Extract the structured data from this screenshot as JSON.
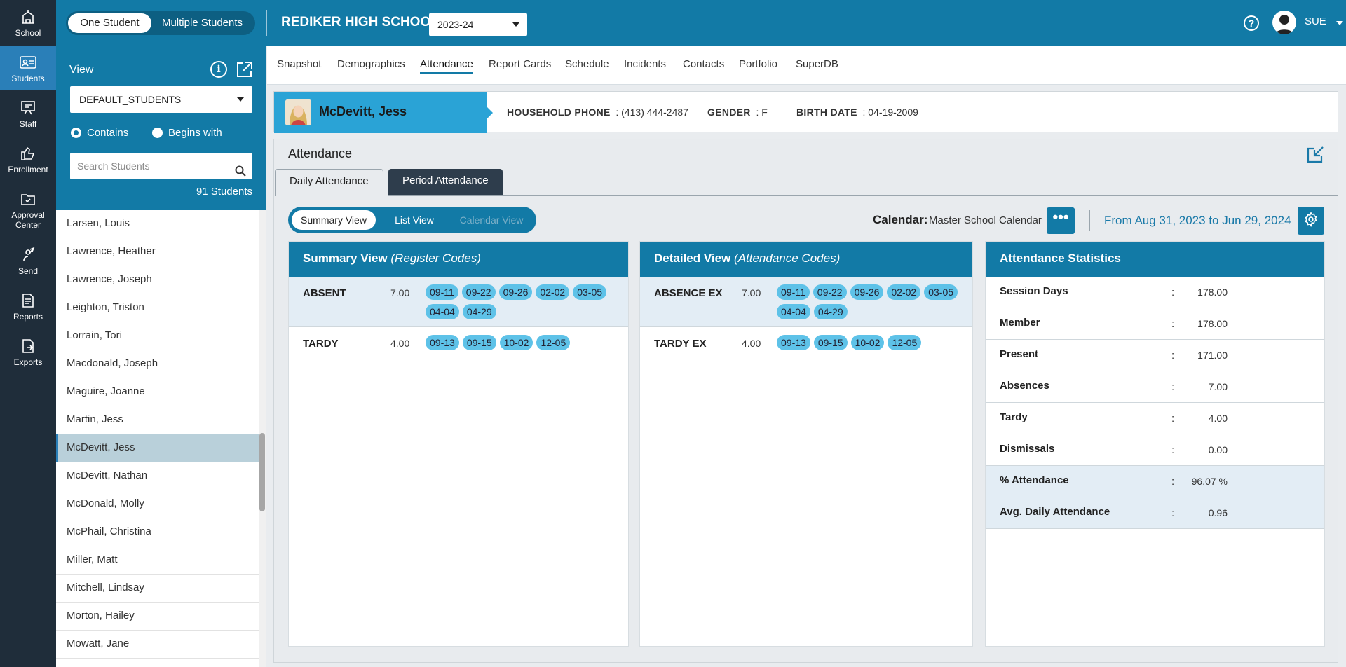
{
  "rail": [
    {
      "label": "School",
      "icon": "school-icon"
    },
    {
      "label": "Students",
      "icon": "students-icon"
    },
    {
      "label": "Staff",
      "icon": "staff-icon"
    },
    {
      "label": "Enrollment",
      "icon": "enrollment-icon"
    },
    {
      "label": "Approval Center",
      "icon": "approval-icon"
    },
    {
      "label": "Send",
      "icon": "send-icon"
    },
    {
      "label": "Reports",
      "icon": "reports-icon"
    },
    {
      "label": "Exports",
      "icon": "exports-icon"
    }
  ],
  "header": {
    "one_student": "One Student",
    "multiple_students": "Multiple Students",
    "school": "REDIKER HIGH SCHOOL",
    "year": "2023-24",
    "help": "?",
    "user": "SUE"
  },
  "sidebar": {
    "view_label": "View",
    "view_value": "DEFAULT_STUDENTS",
    "radio_contains": "Contains",
    "radio_begins": "Begins with",
    "search_placeholder": "Search Students",
    "count": "91 Students",
    "students": [
      "Larsen, Louis",
      "Lawrence, Heather",
      "Lawrence, Joseph",
      "Leighton, Triston",
      "Lorrain, Tori",
      "Macdonald, Joseph",
      "Maguire, Joanne",
      "Martin, Jess",
      "McDevitt, Jess",
      "McDevitt, Nathan",
      "McDonald, Molly",
      "McPhail, Christina",
      "Miller, Matt",
      "Mitchell, Lindsay",
      "Morton, Hailey",
      "Mowatt, Jane"
    ],
    "selected": "McDevitt, Jess"
  },
  "nav": [
    "Snapshot",
    "Demographics",
    "Attendance",
    "Report Cards",
    "Schedule",
    "Incidents",
    "Contacts",
    "Portfolio",
    "SuperDB"
  ],
  "nav_active": "Attendance",
  "banner": {
    "name": "McDevitt, Jess",
    "phone_label": "HOUSEHOLD PHONE",
    "phone": ": (413) 444-2487",
    "gender_label": "GENDER",
    "gender": ": F",
    "birth_label": "BIRTH DATE",
    "birth": ": 04-19-2009"
  },
  "attendance": {
    "title": "Attendance",
    "tab_daily": "Daily Attendance",
    "tab_period": "Period Attendance",
    "view_summary": "Summary View",
    "view_list": "List View",
    "view_calendar": "Calendar View",
    "calendar_label": "Calendar:",
    "calendar_value": "Master School Calendar",
    "dots": "•••",
    "range": "From Aug 31, 2023 to Jun 29, 2024"
  },
  "summary": {
    "title": "Summary View",
    "subtitle": "(Register Codes)",
    "rows": [
      {
        "code": "ABSENT",
        "value": "7.00",
        "dates": [
          "09-11",
          "09-22",
          "09-26",
          "02-02",
          "03-05",
          "04-04",
          "04-29"
        ]
      },
      {
        "code": "TARDY",
        "value": "4.00",
        "dates": [
          "09-13",
          "09-15",
          "10-02",
          "12-05"
        ]
      }
    ]
  },
  "detailed": {
    "title": "Detailed View",
    "subtitle": "(Attendance Codes)",
    "rows": [
      {
        "code": "ABSENCE EX",
        "value": "7.00",
        "dates": [
          "09-11",
          "09-22",
          "09-26",
          "02-02",
          "03-05",
          "04-04",
          "04-29"
        ]
      },
      {
        "code": "TARDY EX",
        "value": "4.00",
        "dates": [
          "09-13",
          "09-15",
          "10-02",
          "12-05"
        ]
      }
    ]
  },
  "stats": {
    "title": "Attendance Statistics",
    "rows": [
      {
        "label": "Session Days",
        "value": "178.00"
      },
      {
        "label": "Member",
        "value": "178.00"
      },
      {
        "label": "Present",
        "value": "171.00"
      },
      {
        "label": "Absences",
        "value": "7.00"
      },
      {
        "label": "Tardy",
        "value": "4.00"
      },
      {
        "label": "Dismissals",
        "value": "0.00"
      },
      {
        "label": "% Attendance",
        "value": "96.07 %"
      },
      {
        "label": "Avg. Daily Attendance",
        "value": "0.96"
      }
    ]
  },
  "colors": {
    "brand": "#127aa6",
    "rail": "#1f2d3a",
    "chip": "#5ec2e8",
    "selected_row": "#b9d0da"
  }
}
